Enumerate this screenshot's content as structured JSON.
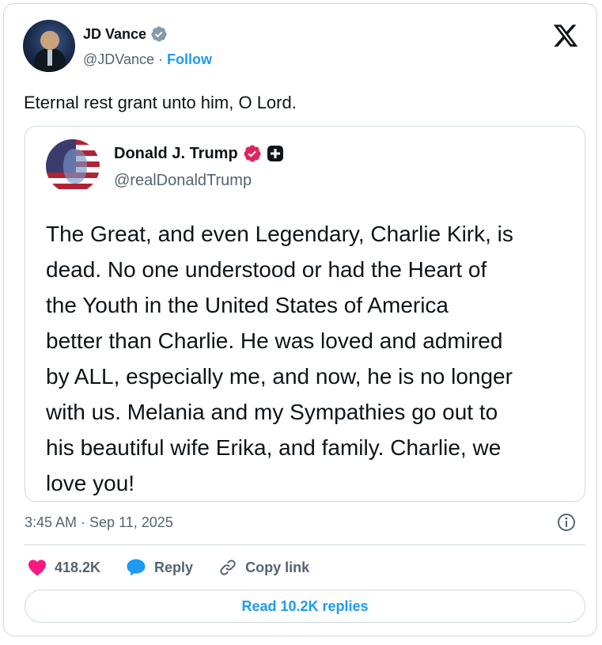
{
  "author": {
    "name": "JD Vance",
    "handle": "@JDVance",
    "follow_label": "Follow"
  },
  "tweet": {
    "text": "Eternal rest grant unto him, O Lord.",
    "timestamp": "3:45 AM · Sep 11, 2025"
  },
  "quoted": {
    "name": "Donald J. Trump",
    "handle": "@realDonaldTrump",
    "lines": [
      "The Great, and even Legendary, Charlie Kirk, is",
      "dead. No one understood or had the Heart of",
      "the Youth in the United States of America",
      "better than Charlie. He was loved and admired",
      "by ALL, especially me, and now, he is no longer",
      "with us. Melania and my Sympathies go out to",
      "his beautiful wife Erika, and family. Charlie, we",
      "love you!"
    ]
  },
  "actions": {
    "likes": "418.2K",
    "reply_label": "Reply",
    "copy_label": "Copy link"
  },
  "read_replies_label": "Read 10.2K replies",
  "colors": {
    "accent": "#1d9bf0",
    "verified_blue": "#1d9bf0",
    "verified_pink": "#e0245e",
    "like_heart": "#f91880",
    "secondary_text": "#536471",
    "border": "#cfd9de"
  },
  "icons": {
    "verified": "verified-badge-icon",
    "x_logo": "x-logo-icon",
    "info": "info-icon",
    "heart": "heart-icon",
    "reply": "reply-bubble-icon",
    "link": "link-icon",
    "plus_badge": "plus-badge-icon"
  }
}
